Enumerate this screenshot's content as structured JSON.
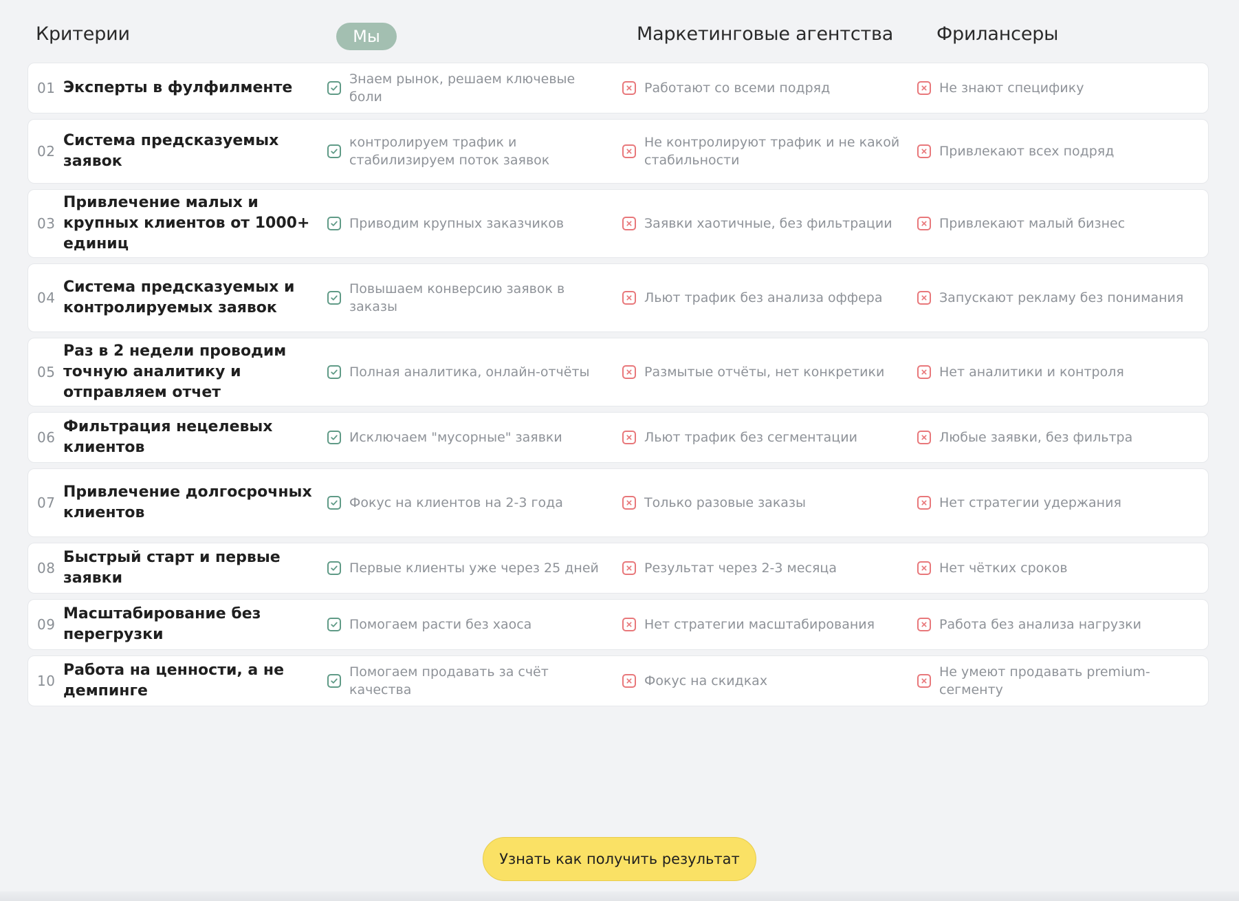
{
  "header": {
    "criteria": "Критерии",
    "us": "Мы",
    "agencies": "Маркетинговые агентства",
    "freelancers": "Фрилансеры"
  },
  "rows": [
    {
      "num": "01",
      "title": "Эксперты в фулфилменте",
      "us": "Знаем рынок, решаем ключевые боли",
      "agencies": "Работают со всеми подряд",
      "freelancers": "Не знают специфику"
    },
    {
      "num": "02",
      "title": "Система предсказуемых заявок",
      "us": "контролируем трафик и стабилизируем поток заявок",
      "agencies": "Не контролируют трафик и не какой стабильности",
      "freelancers": "Привлекают всех подряд"
    },
    {
      "num": "03",
      "title": "Привлечение малых и крупных клиентов от 1000+ единиц",
      "us": "Приводим крупных заказчиков",
      "agencies": "Заявки хаотичные, без фильтрации",
      "freelancers": "Привлекают малый бизнес"
    },
    {
      "num": "04",
      "title": "Система предсказуемых и контролируемых заявок",
      "us": "Повышаем конверсию заявок в заказы",
      "agencies": "Льют трафик без анализа оффера",
      "freelancers": "Запускают рекламу без понимания"
    },
    {
      "num": "05",
      "title": "Раз в 2 недели проводим точную аналитику и отправляем отчет",
      "us": "Полная аналитика, онлайн-отчёты",
      "agencies": "Размытые отчёты, нет конкретики",
      "freelancers": "Нет аналитики и контроля"
    },
    {
      "num": "06",
      "title": "Фильтрация нецелевых клиентов",
      "us": "Исключаем \"мусорные\" заявки",
      "agencies": "Льют трафик без сегментации",
      "freelancers": "Любые заявки, без фильтра"
    },
    {
      "num": "07",
      "title": "Привлечение долгосрочных клиентов",
      "us": "Фокус на клиентов на 2-3 года",
      "agencies": "Только разовые заказы",
      "freelancers": "Нет стратегии удержания"
    },
    {
      "num": "08",
      "title": "Быстрый старт и первые заявки",
      "us": "Первые клиенты уже через 25 дней",
      "agencies": "Результат через 2-3 месяца",
      "freelancers": "Нет чётких сроков"
    },
    {
      "num": "09",
      "title": "Масштабирование без перегрузки",
      "us": "Помогаем расти без хаоса",
      "agencies": "Нет стратегии масштабирования",
      "freelancers": "Работа без анализа нагрузки"
    },
    {
      "num": "10",
      "title": "Работа на ценности, а не демпинге",
      "us": "Помогаем продавать за счёт качества",
      "agencies": "Фокус на скидках",
      "freelancers": "Не умеют продавать premium-сегменту"
    }
  ],
  "cta": {
    "label": "Узнать как получить результат"
  },
  "colors": {
    "pill": "#a3bfb1",
    "check": "#5f9a86",
    "cross": "#e8777a",
    "cta": "#fae165",
    "background": "#f2f3f5"
  },
  "icons": {
    "us": "check-square-icon",
    "competitor": "x-square-icon"
  }
}
